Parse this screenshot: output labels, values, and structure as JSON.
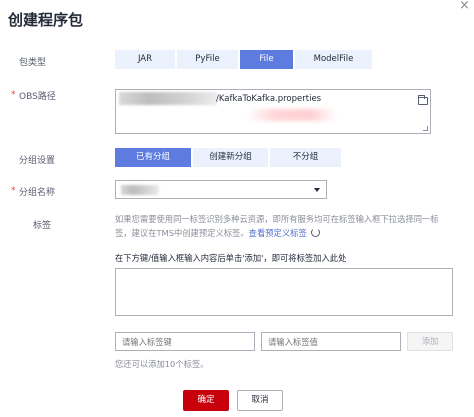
{
  "dialog": {
    "title": "创建程序包",
    "close_glyph": "×"
  },
  "package_type": {
    "label": "包类型",
    "options": [
      "JAR",
      "PyFile",
      "File",
      "ModelFile"
    ],
    "selected": "File"
  },
  "obs_path": {
    "required_mark": "*",
    "label": "OBS路径",
    "value_visible": "/KafkaToKafka.properties",
    "icon": "folder-icon"
  },
  "group_setting": {
    "label": "分组设置",
    "options": [
      "已有分组",
      "创建新分组",
      "不分组"
    ],
    "selected": "已有分组"
  },
  "group_name": {
    "required_mark": "*",
    "label": "分组名称",
    "icon": "chevron-down-icon"
  },
  "tags": {
    "label": "标签",
    "hint": "如果您需要使用同一标签识别多种云资源，即所有服务均可在标签输入框下拉选择同一标签，建议在TMS中创建预定义标签。",
    "hint_link": "查看预定义标签",
    "refresh_icon": "refresh-icon",
    "input_note": "在下方键/值输入框输入内容后单击'添加'，即可将标签加入此处",
    "key_placeholder": "请输入标签键",
    "value_placeholder": "请输入标签值",
    "add_label": "添加",
    "limit_note": "您还可以添加10个标签。"
  },
  "footer": {
    "confirm_label": "确定",
    "cancel_label": "取消"
  },
  "colors": {
    "primary_blue": "#5e7ce0",
    "segment_bg": "#ebf2fd",
    "confirm_red": "#c7000b",
    "link_blue": "#526ecc"
  }
}
